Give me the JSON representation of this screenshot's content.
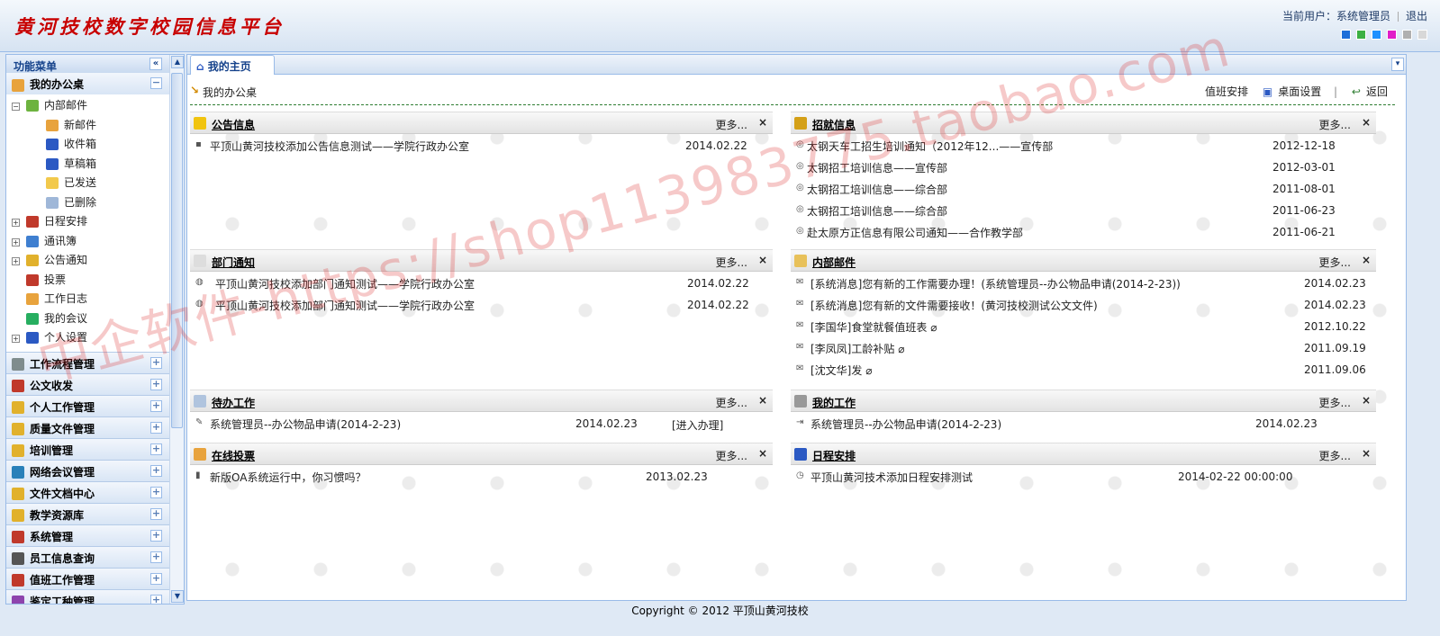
{
  "header": {
    "title": "黄河技校数字校园信息平台",
    "current_user_label": "当前用户：系统管理员",
    "logout": "退出",
    "skin_colors": [
      "#1e6fd9",
      "#3cb043",
      "#1e90ff",
      "#e11ec8",
      "#b0b0b0",
      "#d8d8d8"
    ]
  },
  "sidebar": {
    "title": "功能菜单",
    "top_section": "我的办公桌",
    "tree": [
      {
        "label": "内部邮件",
        "level": 0,
        "expand": "−",
        "icon": "mail-icon",
        "color": "#6db33f"
      },
      {
        "label": "新邮件",
        "level": 1,
        "icon": "new-mail-icon",
        "color": "#e8a33d"
      },
      {
        "label": "收件箱",
        "level": 1,
        "icon": "inbox-icon",
        "color": "#2b59c3"
      },
      {
        "label": "草稿箱",
        "level": 1,
        "icon": "drafts-icon",
        "color": "#2b59c3"
      },
      {
        "label": "已发送",
        "level": 1,
        "icon": "sent-icon",
        "color": "#f2c94c"
      },
      {
        "label": "已删除",
        "level": 1,
        "icon": "deleted-icon",
        "color": "#9fb7d8"
      },
      {
        "label": "日程安排",
        "level": 0,
        "expand": "+",
        "icon": "calendar-icon",
        "color": "#c0392b"
      },
      {
        "label": "通讯簿",
        "level": 0,
        "expand": "+",
        "icon": "address-book-icon",
        "color": "#3f7fd0"
      },
      {
        "label": "公告通知",
        "level": 0,
        "expand": "+",
        "icon": "announcement-icon",
        "color": "#e1b12c"
      },
      {
        "label": "投票",
        "level": 0,
        "icon": "vote-icon",
        "color": "#c0392b"
      },
      {
        "label": "工作日志",
        "level": 0,
        "icon": "work-log-icon",
        "color": "#e8a33d"
      },
      {
        "label": "我的会议",
        "level": 0,
        "icon": "meeting-icon",
        "color": "#27ae60"
      },
      {
        "label": "个人设置",
        "level": 0,
        "expand": "+",
        "icon": "settings-icon",
        "color": "#2b59c3"
      }
    ],
    "sections": [
      {
        "label": "工作流程管理",
        "icon": "workflow-icon",
        "color": "#7f8c8d"
      },
      {
        "label": "公文收发",
        "icon": "document-icon",
        "color": "#c0392b"
      },
      {
        "label": "个人工作管理",
        "icon": "personal-work-icon",
        "color": "#e1b12c"
      },
      {
        "label": "质量文件管理",
        "icon": "folder-icon",
        "color": "#e1b12c"
      },
      {
        "label": "培训管理",
        "icon": "folder-icon",
        "color": "#e1b12c"
      },
      {
        "label": "网络会议管理",
        "icon": "globe-icon",
        "color": "#2980b9"
      },
      {
        "label": "文件文档中心",
        "icon": "folder-icon",
        "color": "#e1b12c"
      },
      {
        "label": "教学资源库",
        "icon": "folder-icon",
        "color": "#e1b12c"
      },
      {
        "label": "系统管理",
        "icon": "system-icon",
        "color": "#c0392b"
      },
      {
        "label": "员工信息查询",
        "icon": "staff-search-icon",
        "color": "#555555"
      },
      {
        "label": "值班工作管理",
        "icon": "duty-icon",
        "color": "#c0392b"
      },
      {
        "label": "鉴定工种管理",
        "icon": "appraisal-icon",
        "color": "#8e44ad"
      }
    ]
  },
  "main": {
    "tab": "我的主页",
    "desk_title": "我的办公桌",
    "duty": "值班安排",
    "desk_settings": "桌面设置",
    "back": "返回",
    "more": "更多...",
    "close": "×",
    "panels": {
      "announce": {
        "title": "公告信息",
        "rows": [
          {
            "t": "平顶山黄河技校添加公告信息测试——学院行政办公室",
            "d": "2014.02.22"
          }
        ]
      },
      "recruit": {
        "title": "招就信息",
        "rows": [
          {
            "t": "太钢天车工招生培训通知（2012年12...——宣传部",
            "d": "2012-12-18"
          },
          {
            "t": "太钢招工培训信息——宣传部",
            "d": "2012-03-01"
          },
          {
            "t": "太钢招工培训信息——综合部",
            "d": "2011-08-01"
          },
          {
            "t": "太钢招工培训信息——综合部",
            "d": "2011-06-23"
          },
          {
            "t": "赴太原方正信息有限公司通知——合作教学部",
            "d": "2011-06-21"
          }
        ]
      },
      "dept": {
        "title": "部门通知",
        "rows": [
          {
            "t": "平顶山黄河技校添加部门通知测试——学院行政办公室",
            "d": "2014.02.22"
          },
          {
            "t": "平顶山黄河技校添加部门通知测试——学院行政办公室",
            "d": "2014.02.22"
          }
        ]
      },
      "mail": {
        "title": "内部邮件",
        "rows": [
          {
            "t": "[系统消息]您有新的工作需要办理！(系统管理员--办公物品申请(2014-2-23))",
            "d": "2014.02.23",
            "clip": false
          },
          {
            "t": "[系统消息]您有新的文件需要接收！(黄河技校测试公文文件)",
            "d": "2014.02.23",
            "clip": false
          },
          {
            "t": "[李国华]食堂就餐值班表",
            "d": "2012.10.22",
            "clip": true
          },
          {
            "t": "[李凤凤]工龄补贴",
            "d": "2011.09.19",
            "clip": true
          },
          {
            "t": "[沈文华]发",
            "d": "2011.09.06",
            "clip": true
          }
        ]
      },
      "todo": {
        "title": "待办工作",
        "rows": [
          {
            "t": "系统管理员--办公物品申请(2014-2-23)",
            "d": "2014.02.23",
            "action": "[进入办理]"
          }
        ]
      },
      "mywork": {
        "title": "我的工作",
        "rows": [
          {
            "t": "系统管理员--办公物品申请(2014-2-23)",
            "d": "2014.02.23"
          }
        ]
      },
      "vote": {
        "title": "在线投票",
        "rows": [
          {
            "t": "新版OA系统运行中，你习惯吗？",
            "d": "2013.02.23"
          }
        ]
      },
      "schedule": {
        "title": "日程安排",
        "rows": [
          {
            "t": "平顶山黄河技术添加日程安排测试",
            "d": "2014-02-22 00:00:00"
          }
        ]
      }
    }
  },
  "footer": "Copyright © 2012 平顶山黄河技校",
  "watermark": "中企软件-https://shop113983775.taobao.com"
}
